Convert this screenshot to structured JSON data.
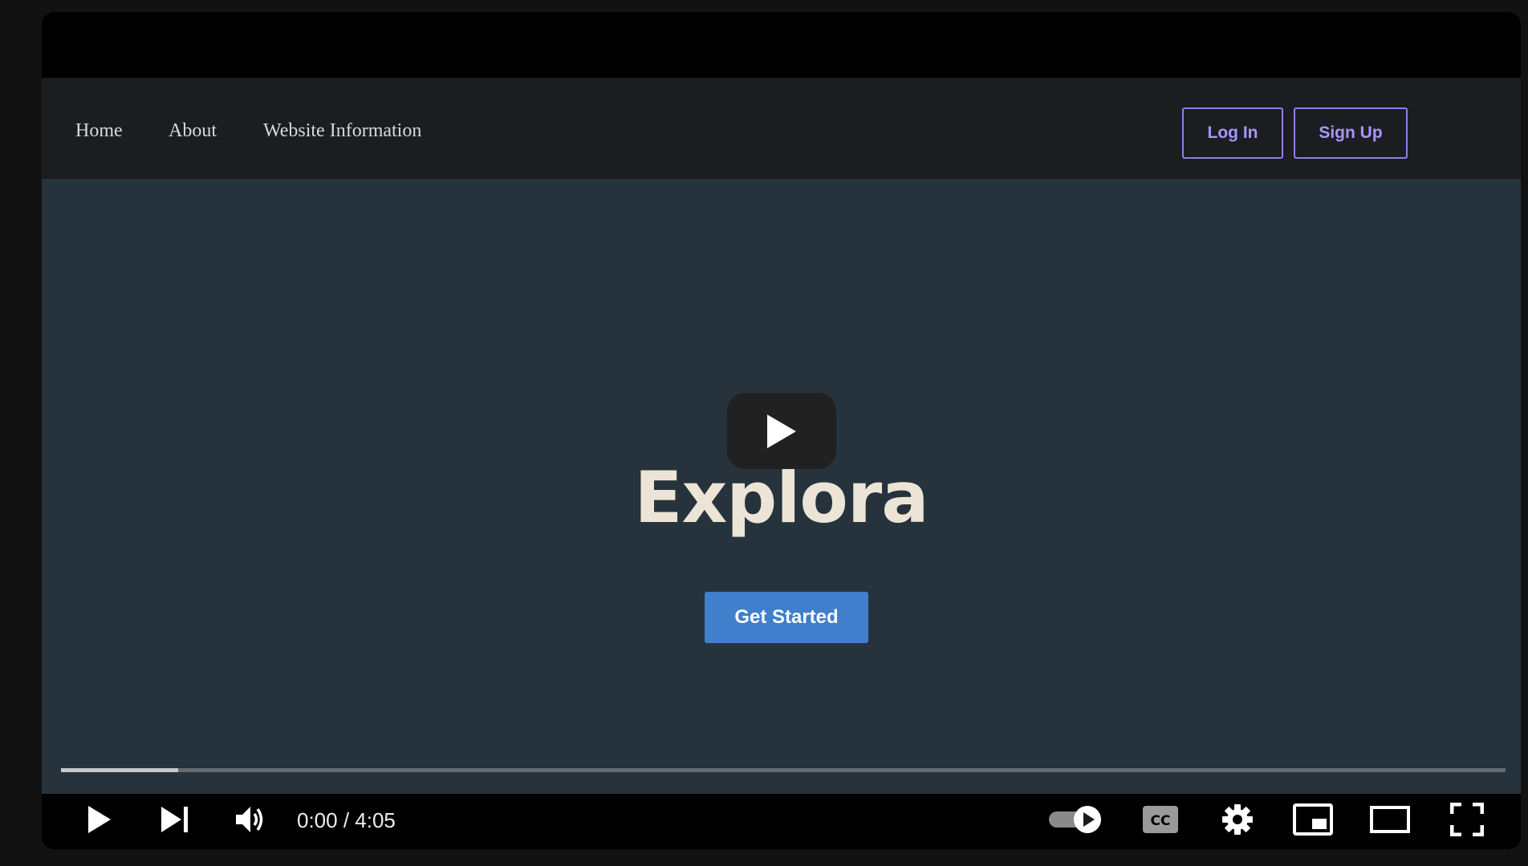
{
  "site": {
    "nav": {
      "home": "Home",
      "about": "About",
      "website_info": "Website Information",
      "login": "Log In",
      "signup": "Sign Up"
    },
    "hero": {
      "title": "Explora",
      "cta": "Get Started"
    }
  },
  "player": {
    "current_time": "0:00",
    "duration": "4:05",
    "time_text": "0:00 / 4:05",
    "progress_fraction": 0.081,
    "icons": {
      "big_play": "play-icon",
      "play": "play-icon",
      "next": "skip-next-icon",
      "volume": "volume-icon",
      "autoplay": "autoplay-toggle-icon",
      "captions": "closed-captions-icon",
      "settings": "gear-icon",
      "miniplayer": "miniplayer-icon",
      "theater": "theater-mode-icon",
      "fullscreen": "fullscreen-icon"
    }
  },
  "colors": {
    "video_bg": "#27333c",
    "nav_bg": "#1c1d20",
    "accent_button": "#3f7fcb",
    "outline_button": "#8c7fea"
  }
}
